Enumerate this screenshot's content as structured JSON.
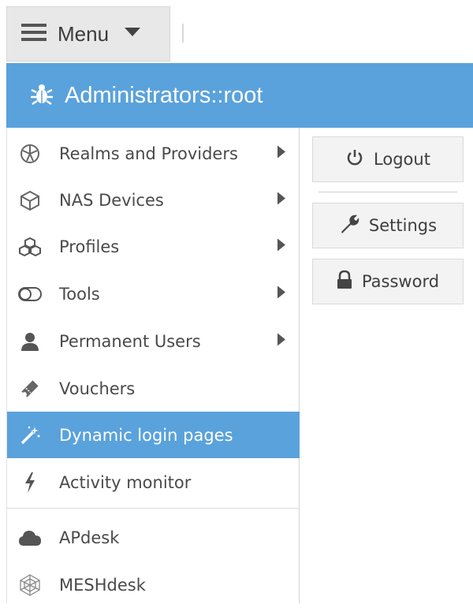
{
  "topbar": {
    "menu_label": "Menu",
    "menu_icon": "hamburger-icon",
    "dropdown_icon": "caret-down-icon"
  },
  "header": {
    "icon": "bug-icon",
    "title": "Administrators::root"
  },
  "menu": {
    "items": [
      {
        "label": "Realms and Providers",
        "icon": "globe-icon",
        "submenu": true
      },
      {
        "label": "NAS Devices",
        "icon": "cube-icon",
        "submenu": true
      },
      {
        "label": "Profiles",
        "icon": "cubes-icon",
        "submenu": true
      },
      {
        "label": "Tools",
        "icon": "toggle-icon",
        "submenu": true
      },
      {
        "label": "Permanent Users",
        "icon": "user-icon",
        "submenu": true
      },
      {
        "label": "Vouchers",
        "icon": "ticket-icon",
        "submenu": false
      },
      {
        "label": "Dynamic login pages",
        "icon": "magic-wand-icon",
        "submenu": false,
        "active": true
      },
      {
        "label": "Activity monitor",
        "icon": "lightning-icon",
        "submenu": false
      },
      {
        "label": "APdesk",
        "icon": "cloud-icon",
        "submenu": false
      },
      {
        "label": "MESHdesk",
        "icon": "mesh-icon",
        "submenu": false
      }
    ]
  },
  "actions": {
    "logout": "Logout",
    "settings": "Settings",
    "password": "Password"
  },
  "colors": {
    "accent": "#5aa2dc",
    "menu_bg": "#e8e8e8",
    "button_bg": "#f3f3f3"
  }
}
